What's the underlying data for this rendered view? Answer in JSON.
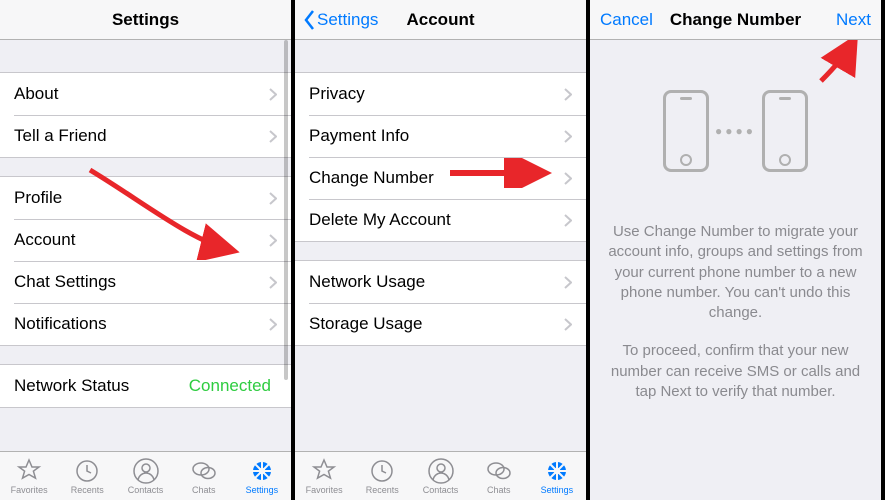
{
  "colors": {
    "tint": "#007aff",
    "connected": "#2ecc40"
  },
  "screen1": {
    "title": "Settings",
    "groups": [
      {
        "rows": [
          {
            "label": "About"
          },
          {
            "label": "Tell a Friend"
          }
        ]
      },
      {
        "rows": [
          {
            "label": "Profile"
          },
          {
            "label": "Account"
          },
          {
            "label": "Chat Settings"
          },
          {
            "label": "Notifications"
          }
        ]
      },
      {
        "rows": [
          {
            "label": "Network Status",
            "value": "Connected",
            "no_chevron": true
          }
        ]
      }
    ]
  },
  "screen2": {
    "back": "Settings",
    "title": "Account",
    "groups": [
      {
        "rows": [
          {
            "label": "Privacy"
          },
          {
            "label": "Payment Info"
          },
          {
            "label": "Change Number"
          },
          {
            "label": "Delete My Account"
          }
        ]
      },
      {
        "rows": [
          {
            "label": "Network Usage"
          },
          {
            "label": "Storage Usage"
          }
        ]
      }
    ]
  },
  "screen3": {
    "left": "Cancel",
    "title": "Change Number",
    "right": "Next",
    "para1": "Use Change Number to migrate your account info, groups and settings from your current phone number to a new phone number. You can't undo this change.",
    "para2": "To proceed, confirm that your new number can receive SMS or calls and tap Next to verify that number."
  },
  "tabs": [
    {
      "id": "favorites",
      "label": "Favorites"
    },
    {
      "id": "recents",
      "label": "Recents"
    },
    {
      "id": "contacts",
      "label": "Contacts"
    },
    {
      "id": "chats",
      "label": "Chats"
    },
    {
      "id": "settings",
      "label": "Settings",
      "active": true
    }
  ]
}
